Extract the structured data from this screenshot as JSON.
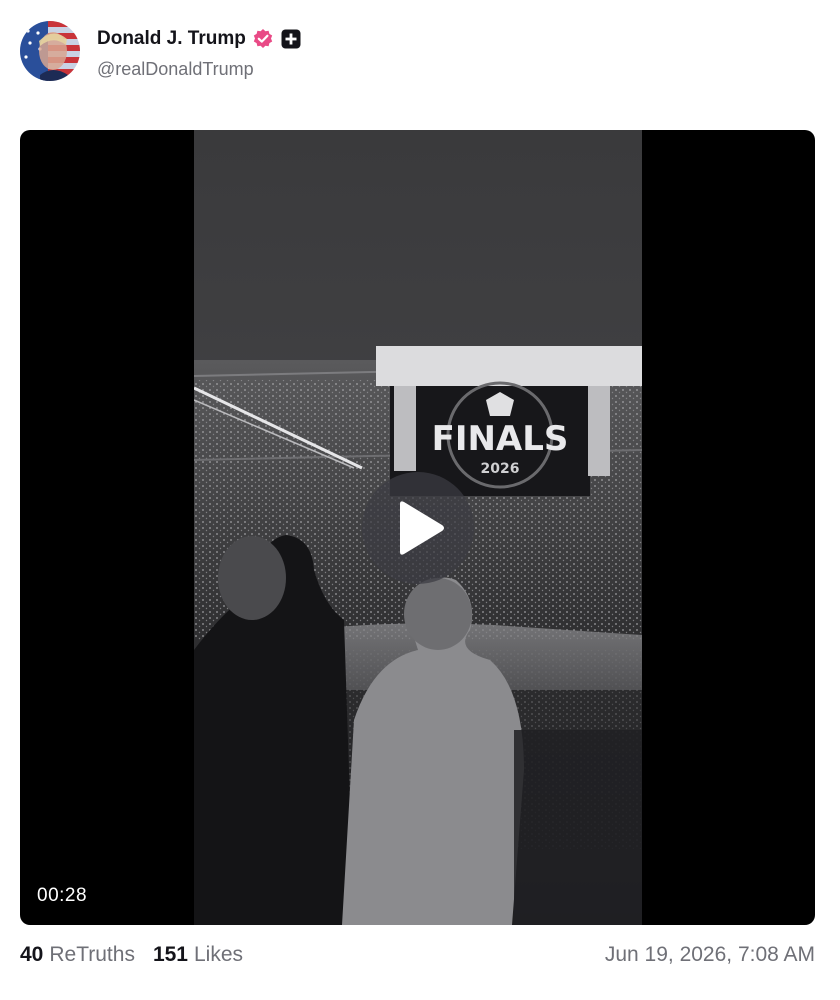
{
  "post": {
    "author": {
      "display_name": "Donald J. Trump",
      "handle": "@realDonaldTrump",
      "verified_icon": "verified-badge-icon",
      "plus_icon": "plus-badge-icon"
    },
    "video": {
      "duration": "00:28",
      "play_icon": "play-icon"
    },
    "stats": {
      "retruths_count": "40",
      "retruths_label": "ReTruths",
      "likes_count": "151",
      "likes_label": "Likes"
    },
    "timestamp": "Jun 19, 2026, 7:08 AM"
  },
  "colors": {
    "verified": "#e94a86",
    "text_primary": "#14141a",
    "text_secondary": "#6f7077",
    "video_background": "#000000"
  }
}
